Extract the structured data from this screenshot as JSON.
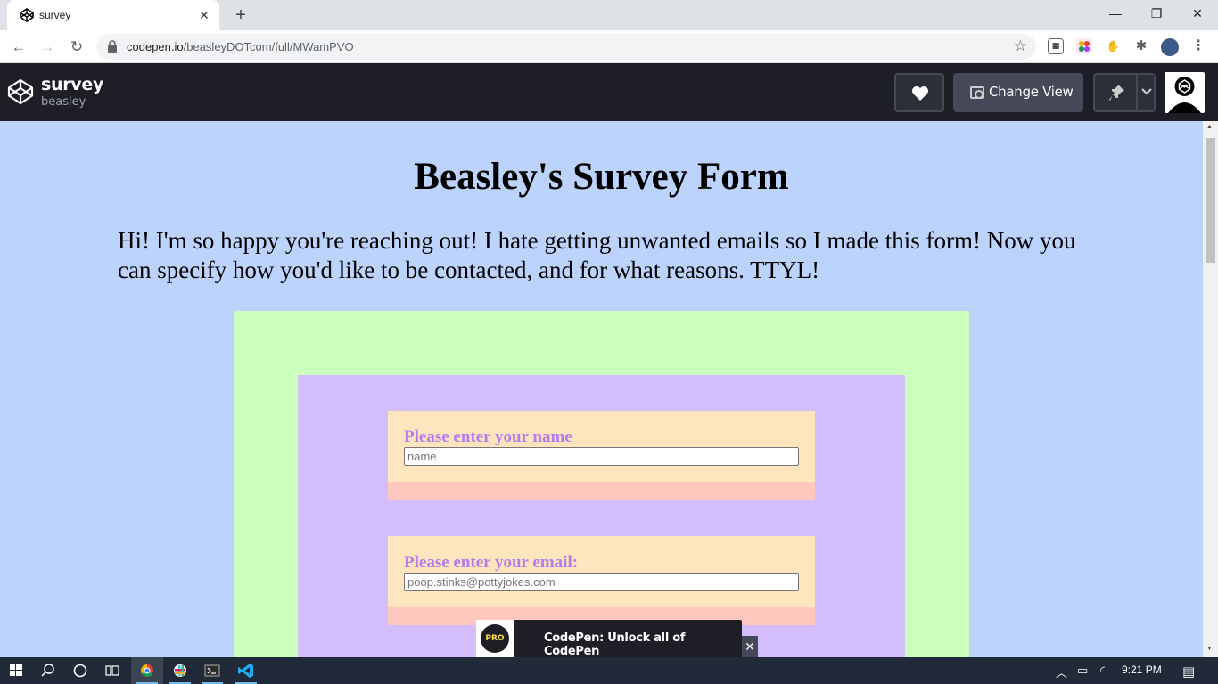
{
  "browser": {
    "tab_title": "survey",
    "new_tab": "+",
    "url_domain": "codepen.io",
    "url_path": "/beasleyDOTcom/full/MWamPVO"
  },
  "codepen": {
    "pen_title": "survey",
    "author": "beasley",
    "change_view_label": "Change View"
  },
  "page": {
    "title": "Beasley's Survey Form",
    "intro": "Hi! I'm so happy you're reaching out! I hate getting unwanted emails so I made this form! Now you can specify how you'd like to be contacted, and for what reasons. TTYL!",
    "fields": [
      {
        "label": "Please enter your name",
        "placeholder": "name"
      },
      {
        "label": "Please enter your email:",
        "placeholder": "poop.stinks@pottyjokes.com"
      }
    ]
  },
  "pro_banner": {
    "badge": "PRO",
    "message": "CodePen: Unlock all of CodePen"
  },
  "taskbar": {
    "clock": "9:21 PM"
  },
  "colors": {
    "page_bg": "#bcd4fd",
    "green_box": "#ccffbb",
    "purple_box": "#d3bdfc",
    "field_card": "#ffe5bd",
    "field_card_bottom": "#ffc7bd",
    "label_text": "#b27ced",
    "codepen_header": "#1e1f26"
  },
  "icons": [
    "codepen-logo-icon",
    "lock-icon",
    "star-icon",
    "heart-icon",
    "eye-icon",
    "pin-icon",
    "chevron-down-icon",
    "close-icon",
    "windows-start-icon",
    "search-icon",
    "chrome-icon",
    "vscode-icon"
  ]
}
